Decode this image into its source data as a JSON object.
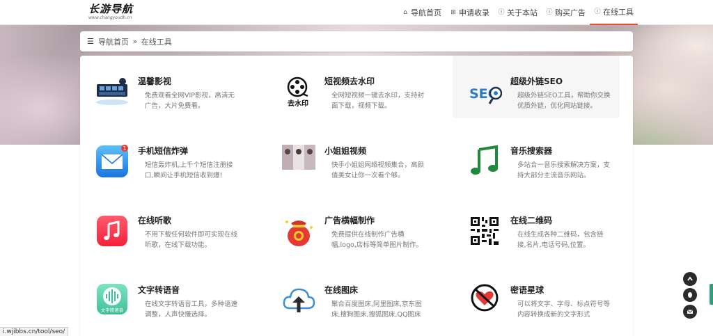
{
  "header": {
    "logo_text": "长游导航",
    "logo_sub": "www.changyoudh.cn",
    "nav": [
      {
        "label": "导航首页",
        "icon": "home-icon"
      },
      {
        "label": "申请收录",
        "icon": "plus-square-icon"
      },
      {
        "label": "关于本站",
        "icon": "info-circle-icon"
      },
      {
        "label": "购买广告",
        "icon": "info-circle-icon"
      },
      {
        "label": "在线工具",
        "icon": "info-circle-icon",
        "active": true
      }
    ]
  },
  "breadcrumb": {
    "icon": "list-icon",
    "home": "导航首页",
    "separator": "»",
    "current": "在线工具"
  },
  "tools": [
    {
      "name": "温馨影视",
      "desc": "免费观看全网VIP影视，高清无广告，大片免费看。",
      "icon": "film-icon"
    },
    {
      "name": "短视频去水印",
      "desc": "全网短视频一键去水印，支持封面下载，视频下载。",
      "icon": "film-reel-icon"
    },
    {
      "name": "超级外链SEO",
      "desc": "超级外链SEO工具，帮助你交换优质外链，优化网站链接。",
      "icon": "seo-magnifier-icon"
    },
    {
      "name": "手机短信炸弹",
      "desc": "短信轰炸机,上千个短信注册接口,瞬间让手机短信收到爆!",
      "icon": "mail-app-icon"
    },
    {
      "name": "小姐姐视频",
      "desc": "快手小姐姐网络视频集合，高颜值美女让你一次看个够。",
      "icon": "video-thumbnail-icon"
    },
    {
      "name": "音乐搜索器",
      "desc": "多站合一音乐搜索解决方案，支持大部分主流音乐网站。",
      "icon": "music-note-icon"
    },
    {
      "name": "在线听歌",
      "desc": "不用下载任何软件即可实现在线听歌，在线下载功能。",
      "icon": "music-app-icon"
    },
    {
      "name": "广告横幅制作",
      "desc": "免费提供在线制作广告横幅,logo,店标等简单图片制作。",
      "icon": "lucky-bag-icon"
    },
    {
      "name": "在线二维码",
      "desc": "在线生成各种二维码，包含链接,名片,电话号码,位置。",
      "icon": "qr-code-icon"
    },
    {
      "name": "文字转语音",
      "desc": "在线文字转语音工具，多种语速调整，人声快慢选择。",
      "icon": "voice-wave-icon"
    },
    {
      "name": "在线图床",
      "desc": "聚合百度图床,阿里图床,京东图床,搜狗图床,搜狐图床,QQ图床",
      "icon": "cloud-upload-icon"
    },
    {
      "name": "密语星球",
      "desc": "可以将文字、字母、标点符号等内容转换成新的文字形式",
      "icon": "no-heart-icon"
    }
  ],
  "mail_badge": "1",
  "voice_label": "文字转语音",
  "watermark_label": "去水印",
  "seo_label": "SEO",
  "status_url": "i.wjibbs.cn/tool/seo/",
  "colors": {
    "accent": "#e74c3c",
    "side_button": "#2b2b2b"
  }
}
